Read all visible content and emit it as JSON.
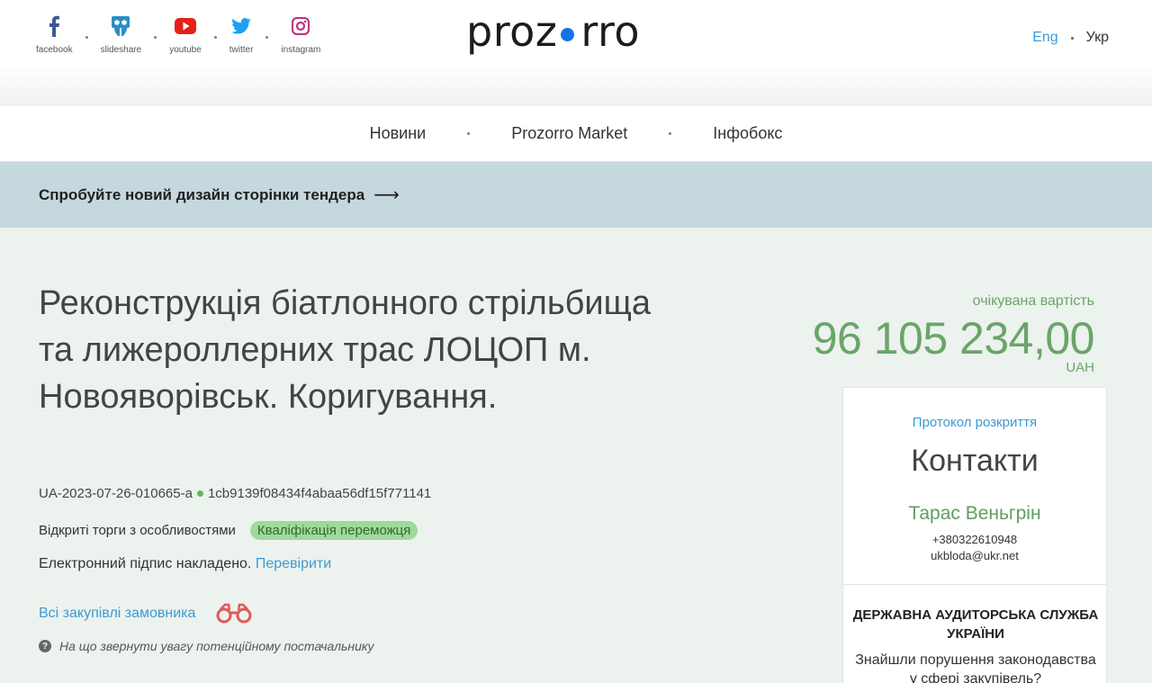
{
  "header": {
    "social": [
      {
        "name": "facebook",
        "label": "facebook",
        "color": "#3b5998"
      },
      {
        "name": "slideshare",
        "label": "slideshare",
        "color": "#2a8fc4"
      },
      {
        "name": "youtube",
        "label": "youtube",
        "color": "#e62117"
      },
      {
        "name": "twitter",
        "label": "twitter",
        "color": "#1da1f2"
      },
      {
        "name": "instagram",
        "label": "instagram",
        "color": "#c13584"
      }
    ],
    "logo_left": "proz",
    "logo_right": "rro",
    "logo_dot_color": "#1473e6",
    "lang_eng": "Eng",
    "lang_ukr": "Укр"
  },
  "nav": {
    "items": [
      {
        "label": "Новини"
      },
      {
        "label": "Prozorro Market"
      },
      {
        "label": "Інфобокс"
      }
    ]
  },
  "banner": {
    "text": "Спробуйте новий дизайн сторінки тендера",
    "arrow": "⟶"
  },
  "tender": {
    "title": "Реконструкція біатлонного стрільбища та лижероллерних трас ЛОЦОП м. Новояворівськ. Коригування.",
    "id": "UA-2023-07-26-010665-a",
    "hash": "1cb9139f08434f4abaa56df15f771141",
    "procedure": "Відкриті торги з особливостями",
    "status": "Кваліфікація переможця",
    "signature_text": "Електронний підпис накладено.",
    "signature_link": "Перевірити",
    "all_purchases": "Всі закупівлі замовника",
    "hint": "На що звернути увагу потенційному постачальнику",
    "hint_icon": "?"
  },
  "value": {
    "label": "очікувана вартість",
    "amount": "96 105 234,00",
    "currency": "UAH",
    "color": "#6aa56a"
  },
  "contacts": {
    "protocol_link": "Протокол розкриття",
    "title": "Контакти",
    "name": "Тарас Веньгрін",
    "phone": "+380322610948",
    "email": "ukbloda@ukr.net",
    "dasu_title": "ДЕРЖАВНА АУДИТОРСЬКА СЛУЖБА УКРАЇНИ",
    "report_text": "Знайшли порушення законодавства у сфері закупівель?"
  }
}
